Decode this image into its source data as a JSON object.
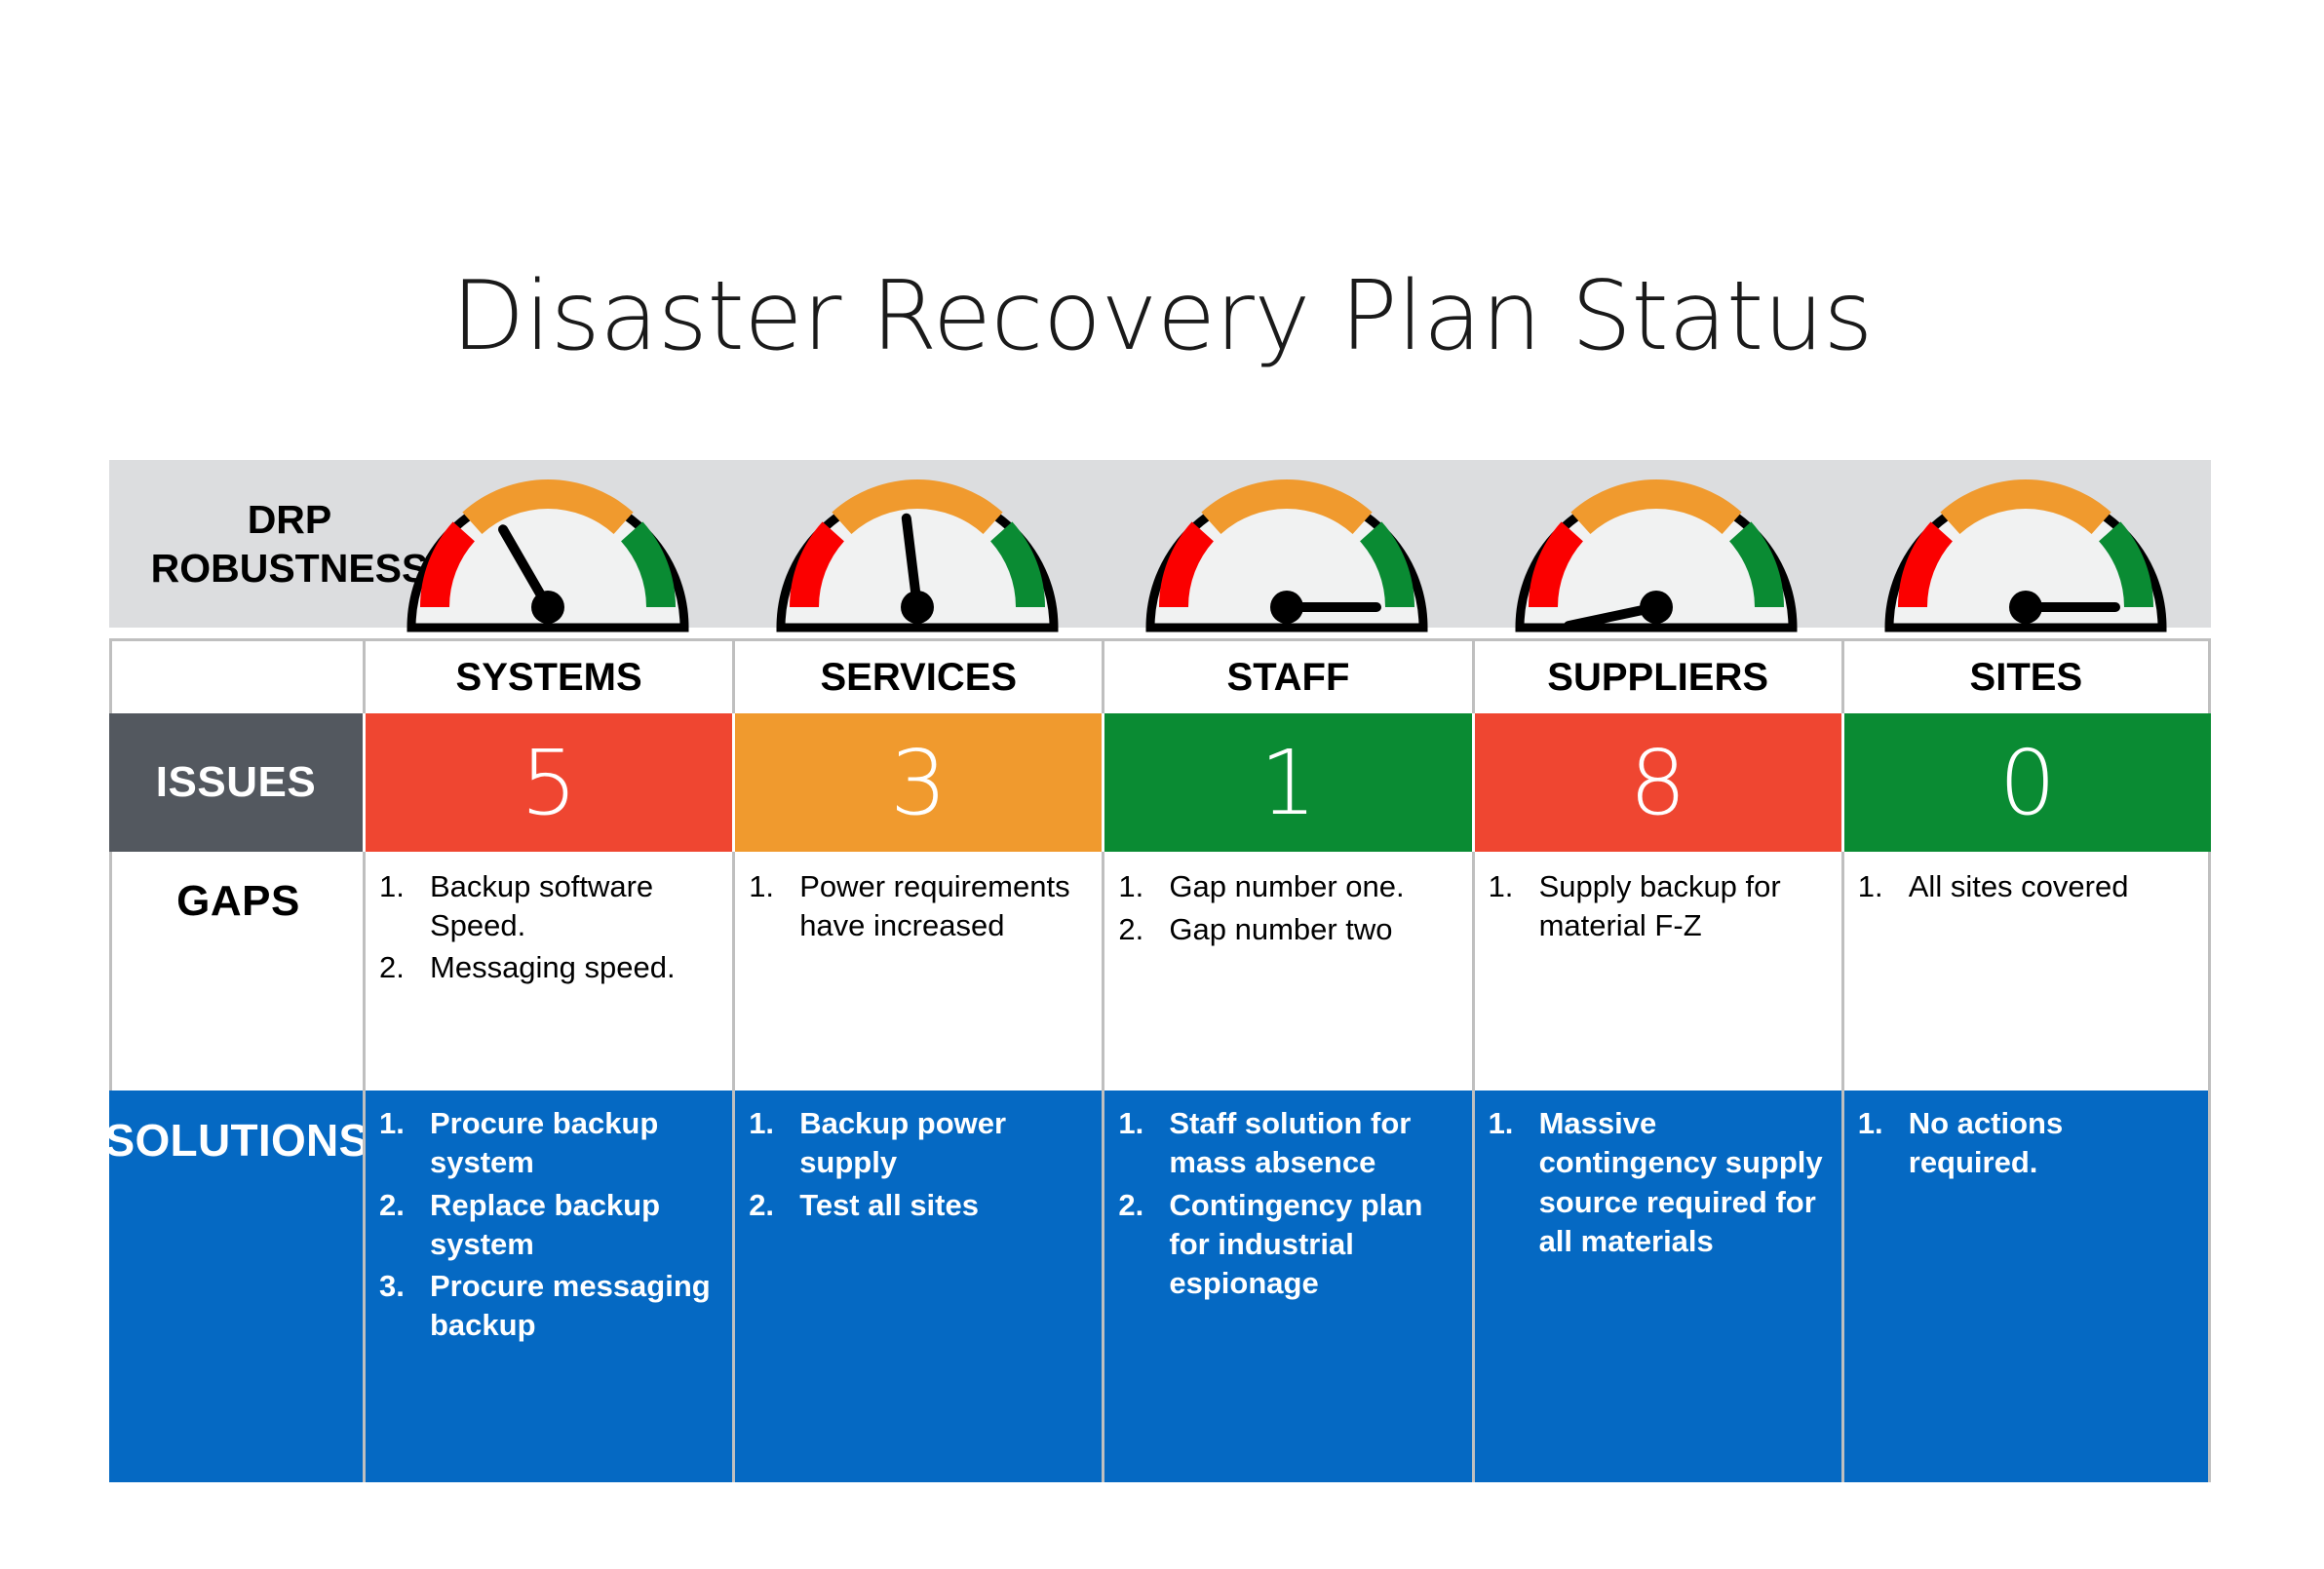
{
  "title": "Disaster Recovery Plan Status",
  "robustness": {
    "label_line1": "DRP",
    "label_line2": "ROBUSTNESS"
  },
  "row_labels": {
    "issues": "ISSUES",
    "gaps": "GAPS",
    "solutions": "SOLUTIONS"
  },
  "colors": {
    "red": "#ef4631",
    "orange": "#f09a2e",
    "green": "#0a8b33",
    "blue": "#0569c3",
    "slate": "#53585f",
    "band_grey": "#dcdddf",
    "border_grey": "#bfbfbf",
    "gauge_red": "#fb0000",
    "gauge_orange": "#f09a2e",
    "gauge_green": "#0a8b33",
    "gauge_face": "#f1f2f2"
  },
  "columns": [
    {
      "header": "SYSTEMS",
      "issues": "5",
      "issues_color": "#ef4631",
      "gauge_angle": -30,
      "gaps": [
        {
          "num": "1.",
          "text": "Backup software Speed."
        },
        {
          "num": "2.",
          "text": "Messaging speed."
        }
      ],
      "solutions": [
        {
          "num": "1.",
          "text": "Procure backup system"
        },
        {
          "num": "2.",
          "text": "Replace backup system"
        },
        {
          "num": "3.",
          "text": "Procure messaging backup"
        }
      ]
    },
    {
      "header": "SERVICES",
      "issues": "3",
      "issues_color": "#f09a2e",
      "gauge_angle": -7,
      "gaps": [
        {
          "num": "1.",
          "text": "Power requirements have increased"
        }
      ],
      "solutions": [
        {
          "num": "1.",
          "text": "Backup power supply"
        },
        {
          "num": "2.",
          "text": "Test all sites"
        }
      ]
    },
    {
      "header": "STAFF",
      "issues": "1",
      "issues_color": "#0a8b33",
      "gauge_angle": 90,
      "gaps": [
        {
          "num": "1.",
          "text": "Gap number one."
        },
        {
          "num": "2.",
          "text": "Gap number two"
        }
      ],
      "solutions": [
        {
          "num": "1.",
          "text": "Staff solution for mass absence"
        },
        {
          "num": "2.",
          "text": "Contingency plan for industrial espionage"
        }
      ]
    },
    {
      "header": "SUPPLIERS",
      "issues": "8",
      "issues_color": "#ef4631",
      "gauge_angle": -102,
      "gaps": [
        {
          "num": "1.",
          "text": "Supply backup for material F-Z"
        }
      ],
      "solutions": [
        {
          "num": "1.",
          "text": "Massive contingency supply source required for all materials"
        }
      ]
    },
    {
      "header": "SITES",
      "issues": "0",
      "issues_color": "#0a8b33",
      "gauge_angle": 90,
      "gaps": [
        {
          "num": "1.",
          "text": "All sites covered"
        }
      ],
      "solutions": [
        {
          "num": "1.",
          "text": "No actions required."
        }
      ]
    }
  ]
}
